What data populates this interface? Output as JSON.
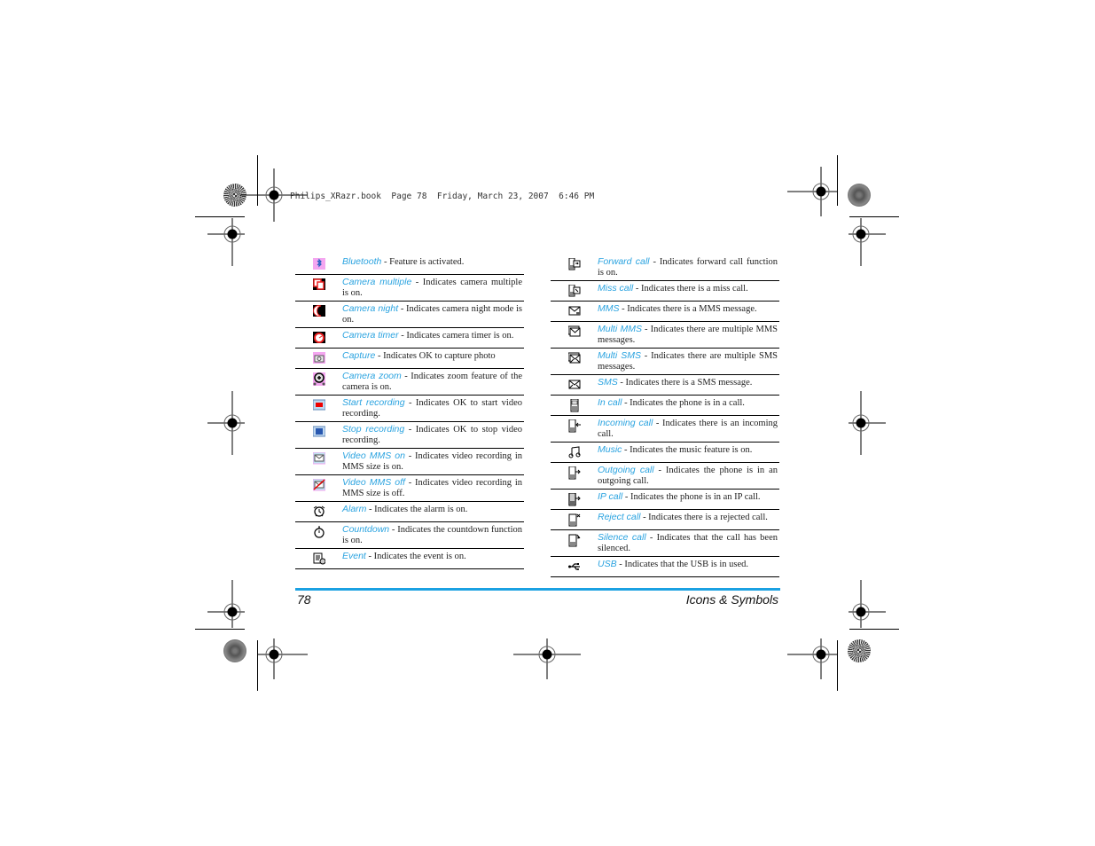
{
  "print_header": "Philips_XRazr.book  Page 78  Friday, March 23, 2007  6:46 PM",
  "left_column": [
    {
      "icon": "bluetooth-icon",
      "term": "Bluetooth",
      "desc": " - Feature is activated."
    },
    {
      "icon": "camera-multiple-icon",
      "term": "Camera multiple",
      "desc": " - Indicates camera multiple is on."
    },
    {
      "icon": "camera-night-icon",
      "term": "Camera night",
      "desc": " - Indicates camera night mode is on."
    },
    {
      "icon": "camera-timer-icon",
      "term": "Camera timer",
      "desc": " - Indicates camera timer is on."
    },
    {
      "icon": "capture-icon",
      "term": "Capture",
      "desc": " - Indicates OK to capture photo"
    },
    {
      "icon": "camera-zoom-icon",
      "term": "Camera zoom",
      "desc": " - Indicates zoom feature of the camera is on."
    },
    {
      "icon": "start-recording-icon",
      "term": "Start recording",
      "desc": " - Indicates OK to start video recording."
    },
    {
      "icon": "stop-recording-icon",
      "term": "Stop recording",
      "desc": " - Indicates OK to stop video recording."
    },
    {
      "icon": "video-mms-on-icon",
      "term": "Video MMS on",
      "desc": " - Indicates video recording in MMS size is on."
    },
    {
      "icon": "video-mms-off-icon",
      "term": "Video MMS off",
      "desc": " - Indicates video recording in MMS size is off."
    },
    {
      "icon": "alarm-icon",
      "term": "Alarm",
      "desc": " - Indicates the alarm is on."
    },
    {
      "icon": "countdown-icon",
      "term": "Countdown",
      "desc": " - Indicates the countdown function is on."
    },
    {
      "icon": "event-icon",
      "term": "Event",
      "desc": " - Indicates the event is on."
    }
  ],
  "right_column": [
    {
      "icon": "forward-call-icon",
      "term": "Forward call",
      "desc": " - Indicates forward call function is on."
    },
    {
      "icon": "miss-call-icon",
      "term": "Miss call",
      "desc": " - Indicates there is a miss call."
    },
    {
      "icon": "mms-icon",
      "term": "MMS",
      "desc": " - Indicates there is a MMS message."
    },
    {
      "icon": "multi-mms-icon",
      "term": "Multi MMS",
      "desc": " - Indicates there are multiple MMS messages."
    },
    {
      "icon": "multi-sms-icon",
      "term": "Multi SMS",
      "desc": " - Indicates there are multiple SMS messages."
    },
    {
      "icon": "sms-icon",
      "term": "SMS",
      "desc": " - Indicates there is a SMS message."
    },
    {
      "icon": "in-call-icon",
      "term": "In call",
      "desc": " - Indicates the phone is in a call."
    },
    {
      "icon": "incoming-call-icon",
      "term": "Incoming call",
      "desc": " - Indicates there is an incoming call."
    },
    {
      "icon": "music-icon",
      "term": "Music",
      "desc": " - Indicates the music feature is on."
    },
    {
      "icon": "outgoing-call-icon",
      "term": "Outgoing call",
      "desc": " - Indicates the phone is in an outgoing call."
    },
    {
      "icon": "ip-call-icon",
      "term": "IP call",
      "desc": " - Indicates the phone is in an IP call."
    },
    {
      "icon": "reject-call-icon",
      "term": "Reject call",
      "desc": " - Indicates there is a rejected call."
    },
    {
      "icon": "silence-call-icon",
      "term": "Silence call",
      "desc": " - Indicates that the call has been silenced."
    },
    {
      "icon": "usb-icon",
      "term": "USB",
      "desc": " - Indicates that the USB is in used."
    }
  ],
  "footer": {
    "page_number": "78",
    "section_title": "Icons & Symbols"
  },
  "colors": {
    "accent": "#1ba1e2",
    "term_text": "#2aa3e0"
  }
}
